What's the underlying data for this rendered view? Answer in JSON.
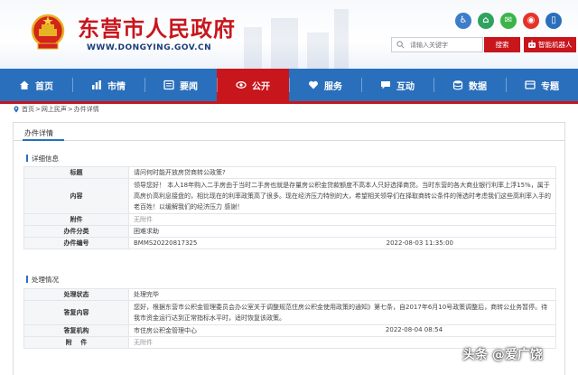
{
  "header": {
    "title": "东营市人民政府",
    "url": "WWW.DONGYING.GOV.CN",
    "search_placeholder": "请输入关键字",
    "search_label": "搜索",
    "robot_label": "智能机器人"
  },
  "nav": {
    "items": [
      {
        "label": "首页",
        "icon": "home-icon"
      },
      {
        "label": "市情",
        "icon": "chart-icon"
      },
      {
        "label": "要闻",
        "icon": "news-icon"
      },
      {
        "label": "公开",
        "icon": "eye-icon",
        "active": true
      },
      {
        "label": "服务",
        "icon": "heart-icon"
      },
      {
        "label": "互动",
        "icon": "chat-icon"
      },
      {
        "label": "数据",
        "icon": "database-icon"
      },
      {
        "label": "专题",
        "icon": "topic-icon"
      }
    ]
  },
  "breadcrumb": [
    "首页",
    "网上民声",
    "办件详情"
  ],
  "panel": {
    "tab": "办件详情"
  },
  "details": {
    "heading": "详细信息",
    "rows": {
      "title_k": "标题",
      "title_v": "请问何时能开放房贷商转公政策?",
      "content_k": "内容",
      "content_v": "领导您好！ 本人18年购入二手房由于当时二手房也就是存量房公积金贷款额度不高本人只好选择商贷。当时东营的各大商业银行利率上浮15%，属于高房价高利息接盘的，相比现在的利率政策高了很多。现在经济压力特别的大，希望相关领导们在择取商转公条件的筛选时考虑我们这些高利率入手的老百姓！以缓解我们的经济压力 感谢！",
      "attach_k": "附件",
      "attach_v": "无附件",
      "category_k": "办件分类",
      "category_v": "困难求助",
      "number_k": "办件编号",
      "number_v": "BMMS20220817325",
      "time": "2022-08-03 11:35:00"
    }
  },
  "handling": {
    "heading": "处理情况",
    "rows": {
      "status_k": "处理状态",
      "status_v": "处理完毕",
      "reply_k": "答复内容",
      "reply_v": "您好，根据东营市公积金管理委员会办公室关于调整规范住房公积金使用政策的通知》第七条，自2017年6月10号政策调整后，商转公业务暂停。待我市资金运行达到正常指标水平时，适时恢复该政策。",
      "org_k": "答复机构",
      "org_v": "市住房公积金管理中心",
      "time": "2022-08-04 08:54",
      "attach_k": "附    件",
      "attach_v": "无附件"
    }
  },
  "watermark": "头条 @爱广饶",
  "colors": {
    "brand_red": "#c8161d",
    "nav_blue": "#2a6fbb"
  }
}
